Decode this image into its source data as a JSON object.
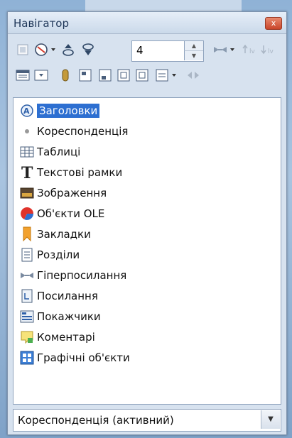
{
  "window": {
    "title": "Навігатор",
    "close_label": "x"
  },
  "toolbar": {
    "spin_value": "4"
  },
  "tree": {
    "items": [
      {
        "label": "Заголовки",
        "icon": "headings-icon",
        "selected": true
      },
      {
        "label": "Кореспонденція",
        "icon": "bullet-icon"
      },
      {
        "label": "Таблиці",
        "icon": "table-icon"
      },
      {
        "label": "Текстові рамки",
        "icon": "text-frame-icon"
      },
      {
        "label": "Зображення",
        "icon": "image-icon"
      },
      {
        "label": "Об'єкти OLE",
        "icon": "ole-object-icon"
      },
      {
        "label": "Закладки",
        "icon": "bookmark-icon"
      },
      {
        "label": "Розділи",
        "icon": "section-icon"
      },
      {
        "label": "Гіперпосилання",
        "icon": "hyperlink-icon"
      },
      {
        "label": "Посилання",
        "icon": "reference-icon"
      },
      {
        "label": "Покажчики",
        "icon": "index-icon"
      },
      {
        "label": "Коментарі",
        "icon": "comment-icon"
      },
      {
        "label": "Графічні об'єкти",
        "icon": "drawing-object-icon"
      }
    ]
  },
  "document_select": {
    "value": "Кореспонденція (активний)"
  },
  "colors": {
    "selection": "#2d6fd1",
    "frame_border": "#8fa3bd",
    "panel_bg": "#d7e2ef"
  }
}
